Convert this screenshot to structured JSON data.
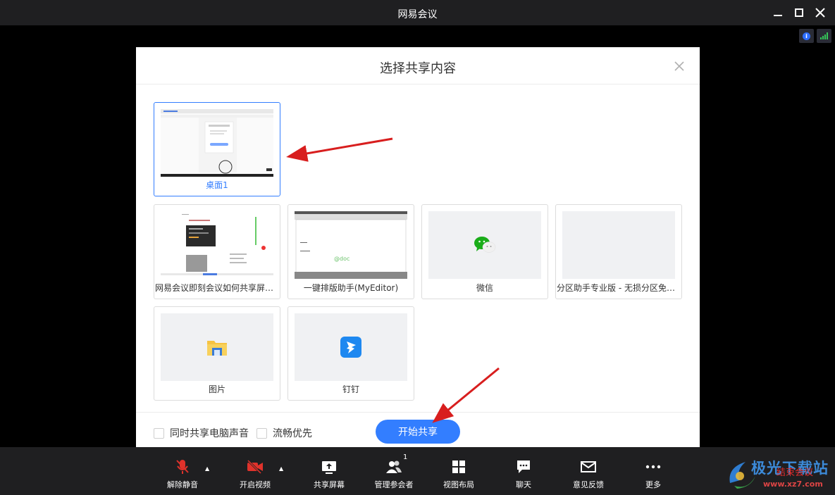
{
  "window": {
    "title": "网易会议"
  },
  "dialog": {
    "title": "选择共享内容",
    "items": [
      {
        "label": "桌面1",
        "selected": true
      },
      {
        "label": "网易会议即刻会议如何共享屏幕..."
      },
      {
        "label": "一键排版助手(MyEditor)"
      },
      {
        "label": "微信"
      },
      {
        "label": "分区助手专业版 - 无损分区免费..."
      },
      {
        "label": "图片"
      },
      {
        "label": "钉钉"
      }
    ],
    "options": [
      {
        "label": "同时共享电脑声音",
        "checked": false
      },
      {
        "label": "流畅优先",
        "checked": false
      }
    ],
    "start_button": "开始共享"
  },
  "toolbar": {
    "items": [
      {
        "label": "解除静音",
        "icon": "mic-muted-icon"
      },
      {
        "label": "开启视频",
        "icon": "video-off-icon"
      },
      {
        "label": "共享屏幕",
        "icon": "share-screen-icon"
      },
      {
        "label": "管理参会者",
        "icon": "participants-icon",
        "badge": "1"
      },
      {
        "label": "视图布局",
        "icon": "grid-layout-icon"
      },
      {
        "label": "聊天",
        "icon": "chat-icon"
      },
      {
        "label": "意见反馈",
        "icon": "mail-icon"
      },
      {
        "label": "更多",
        "icon": "more-icon"
      }
    ],
    "end_meeting": "结束会议"
  },
  "watermark": {
    "brand": "极光下载站",
    "url": "www.xz7.com"
  },
  "colors": {
    "accent": "#337eff",
    "muted_red": "#e02b2b",
    "toolbar_bg": "#1f1f21"
  }
}
